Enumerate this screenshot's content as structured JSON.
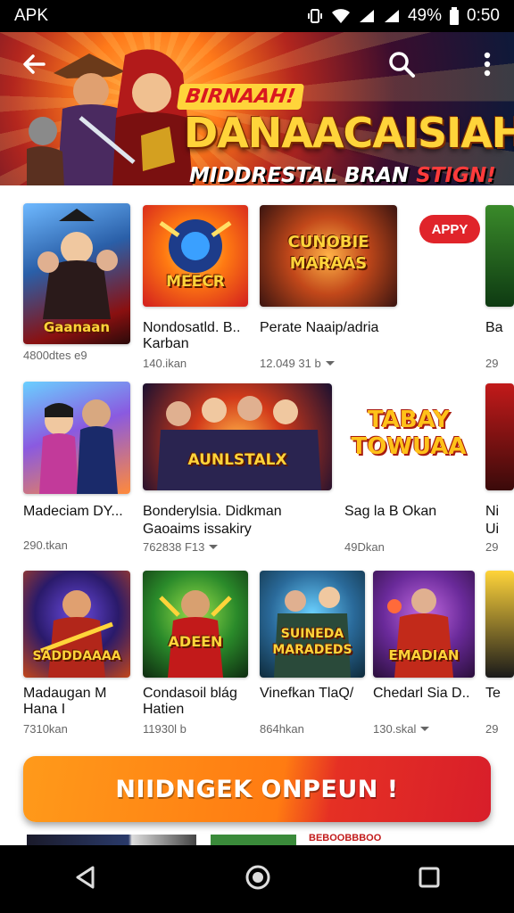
{
  "status_bar": {
    "left_text": "APK",
    "battery": "49%",
    "time": "0:50"
  },
  "banner": {
    "title_small": "BIRNAAH!",
    "title": "DANAACAISIAH",
    "subtitle_a": "MIDDRESTAL BRAN",
    "subtitle_b": "STIGN!"
  },
  "apply_badge": "APPY",
  "cards": [
    {
      "title": "Gaanaan",
      "name_line1": "",
      "name_line2": "",
      "meta": "4800dtes e9"
    },
    {
      "title": "",
      "thumb_text": "MEECR",
      "name_line1": "Nondosatld. B..",
      "name_line2": "Karban",
      "meta": "140.ikan"
    },
    {
      "title": "",
      "thumb_text": "CUNOBIE MARAAS",
      "name_line1": "Perate Naaip/adria",
      "name_line2": "",
      "meta": "12.049 31 b"
    },
    {
      "name_line1": "Ba",
      "meta": "29"
    },
    {
      "name_line1": "Madeciam DY...",
      "meta": "290.tkan"
    },
    {
      "thumb_text": "AUNLSTALX",
      "name_line1": "Bonderylsia. Didkman",
      "name_line2": "Gaoaims issakiry",
      "meta": "762838 F13"
    },
    {
      "thumb_text": "TABAY TOWUAA",
      "name_line1": "Sag la B Okan",
      "meta": "49Dkan"
    },
    {
      "name_line1": "Ni",
      "name_line2": "Ui",
      "meta": "29"
    },
    {
      "thumb_text": "SADDDAAAA",
      "name_line1": "Madaugan M",
      "name_line2": "Hana I",
      "meta": "7310kan"
    },
    {
      "thumb_text": "ADEEN",
      "name_line1": "Condasoil blág",
      "name_line2": "Hatien",
      "meta": "11930l b"
    },
    {
      "thumb_text": "SUINEDA MARADEDS",
      "name_line1": "Vinefkan TlaQ/",
      "meta": "864hkan"
    },
    {
      "thumb_text": "EMADIAN",
      "name_line1": "Chedarl Sia D..",
      "meta": "130.skal"
    },
    {
      "name_line1": "Te",
      "meta": "29"
    }
  ],
  "cta": {
    "label": "NIIDNGEK ONPEUN !"
  },
  "peek_text": "BEBOOBBBOO"
}
